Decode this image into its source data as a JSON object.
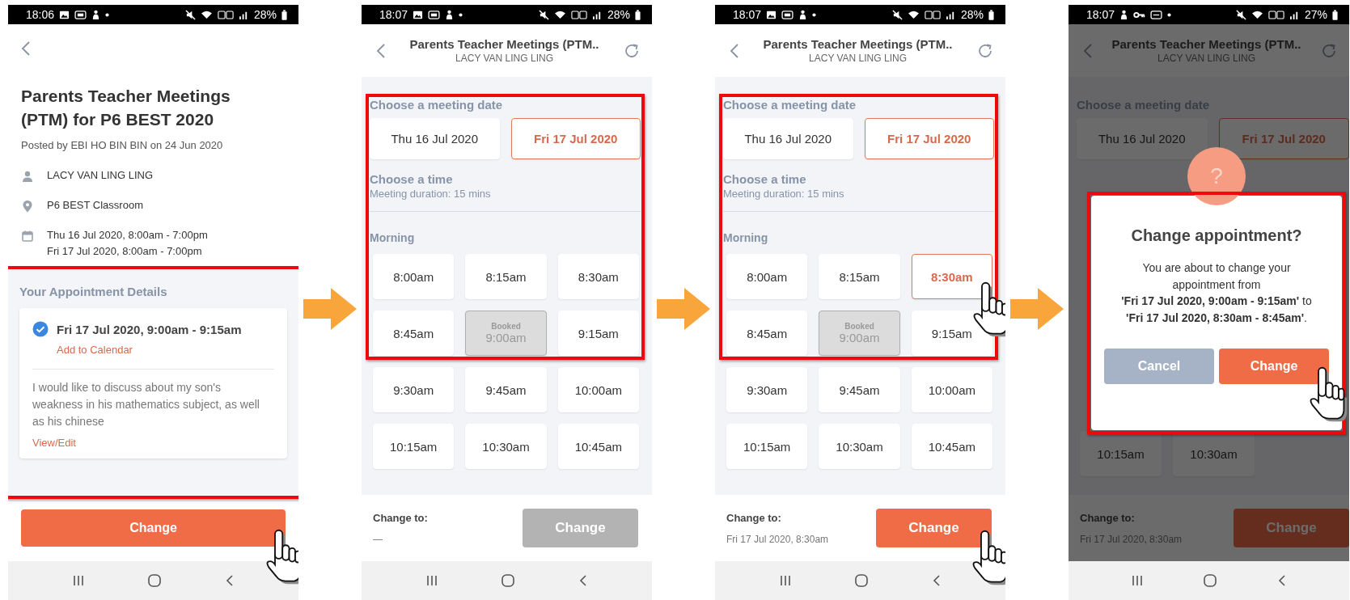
{
  "screens": [
    {
      "kind": "details",
      "status_bar": {
        "time": "18:06",
        "notifications": [
          {
            "kind": "image"
          },
          {
            "kind": "app"
          },
          {
            "kind": "figure"
          },
          {
            "kind": "dot"
          }
        ],
        "battery": "28%"
      },
      "title": "Parents Teacher Meetings (PTM) for P6 BEST 2020",
      "posted": "Posted by EBI HO BIN BIN on 24 Jun 2020",
      "info": [
        {
          "kind": "person",
          "lines": [
            "LACY VAN LING LING"
          ]
        },
        {
          "kind": "location",
          "lines": [
            "P6 BEST Classroom"
          ]
        },
        {
          "kind": "calendar",
          "lines": [
            "Thu 16 Jul 2020, 8:00am - 7:00pm",
            "Fri 17 Jul 2020, 8:00am - 7:00pm"
          ]
        }
      ],
      "appointment": {
        "heading": "Your Appointment Details",
        "highlighted": true,
        "confirmed": true,
        "slot": "Fri 17 Jul 2020, 9:00am - 9:15am",
        "calendar_link": "Add to Calendar",
        "note": "I would like to discuss about my son's weakness in his mathematics subject, as well as his chinese",
        "edit_link": "View/Edit"
      },
      "button": {
        "label": "Change",
        "disabled": false,
        "tapped": true
      }
    },
    {
      "kind": "picker",
      "status_bar": {
        "time": "18:07",
        "notifications": [
          {
            "kind": "image"
          },
          {
            "kind": "app"
          },
          {
            "kind": "figure"
          },
          {
            "kind": "dot"
          }
        ],
        "battery": "28%"
      },
      "header": {
        "title": "Parents Teacher Meetings (PTM..",
        "subtitle": "LACY VAN LING LING"
      },
      "date_section": {
        "heading": "Choose a meeting date",
        "highlighted": true,
        "dates": [
          {
            "label": "Thu 16 Jul 2020",
            "selected": false
          },
          {
            "label": "Fri 17 Jul 2020",
            "selected": true
          }
        ]
      },
      "time_section": {
        "heading": "Choose a time",
        "duration": "Meeting duration: 15 mins",
        "period": "Morning"
      },
      "slot_rows": [
        {
          "slots": [
            {
              "label": "8:00am",
              "selected": false,
              "booked": false
            },
            {
              "label": "8:15am",
              "selected": false,
              "booked": false
            },
            {
              "label": "8:30am",
              "selected": false,
              "booked": false
            }
          ]
        },
        {
          "slots": [
            {
              "label": "8:45am",
              "selected": false,
              "booked": false
            },
            {
              "label": "9:00am",
              "note": "Booked",
              "selected": false,
              "booked": true
            },
            {
              "label": "9:15am",
              "selected": false,
              "booked": false
            }
          ]
        },
        {
          "slots": [
            {
              "label": "9:30am",
              "selected": false,
              "booked": false
            },
            {
              "label": "9:45am",
              "selected": false,
              "booked": false
            },
            {
              "label": "10:00am",
              "selected": false,
              "booked": false
            }
          ]
        },
        {
          "slots": [
            {
              "label": "10:15am",
              "selected": false,
              "booked": false
            },
            {
              "label": "10:30am",
              "selected": false,
              "booked": false
            },
            {
              "label": "10:45am",
              "selected": false,
              "booked": false
            }
          ]
        }
      ],
      "footer": {
        "label": "Change to:",
        "value": "—",
        "button": {
          "label": "Change",
          "disabled": true,
          "tapped": false
        }
      }
    },
    {
      "kind": "picker",
      "status_bar": {
        "time": "18:07",
        "notifications": [
          {
            "kind": "image"
          },
          {
            "kind": "app"
          },
          {
            "kind": "figure"
          },
          {
            "kind": "dot"
          }
        ],
        "battery": "28%"
      },
      "header": {
        "title": "Parents Teacher Meetings (PTM..",
        "subtitle": "LACY VAN LING LING"
      },
      "date_section": {
        "heading": "Choose a meeting date",
        "highlighted": true,
        "dates": [
          {
            "label": "Thu 16 Jul 2020",
            "selected": false
          },
          {
            "label": "Fri 17 Jul 2020",
            "selected": true
          }
        ]
      },
      "time_section": {
        "heading": "Choose a time",
        "duration": "Meeting duration: 15 mins",
        "period": "Morning"
      },
      "slot_rows": [
        {
          "slots": [
            {
              "label": "8:00am",
              "selected": false,
              "booked": false
            },
            {
              "label": "8:15am",
              "selected": false,
              "booked": false
            },
            {
              "label": "8:30am",
              "selected": true,
              "booked": false
            }
          ]
        },
        {
          "slots": [
            {
              "label": "8:45am",
              "selected": false,
              "booked": false
            },
            {
              "label": "9:00am",
              "note": "Booked",
              "selected": false,
              "booked": true
            },
            {
              "label": "9:15am",
              "selected": false,
              "booked": false
            }
          ]
        },
        {
          "slots": [
            {
              "label": "9:30am",
              "selected": false,
              "booked": false
            },
            {
              "label": "9:45am",
              "selected": false,
              "booked": false
            },
            {
              "label": "10:00am",
              "selected": false,
              "booked": false
            }
          ]
        },
        {
          "slots": [
            {
              "label": "10:15am",
              "selected": false,
              "booked": false
            },
            {
              "label": "10:30am",
              "selected": false,
              "booked": false
            },
            {
              "label": "10:45am",
              "selected": false,
              "booked": false
            }
          ]
        }
      ],
      "footer": {
        "label": "Change to:",
        "value": "Fri 17 Jul 2020, 8:30am",
        "button": {
          "label": "Change",
          "disabled": false,
          "tapped": true
        }
      }
    },
    {
      "kind": "confirm",
      "status_bar": {
        "time": "18:07",
        "notifications": [
          {
            "kind": "figure"
          },
          {
            "kind": "key"
          },
          {
            "kind": "card"
          },
          {
            "kind": "dot"
          }
        ],
        "battery": "27%"
      },
      "header": {
        "title": "Parents Teacher Meetings (PTM..",
        "subtitle": "LACY VAN LING LING"
      },
      "date_section": {
        "heading": "Choose a meeting date",
        "highlighted": false,
        "dates": [
          {
            "label": "Thu 16 Jul 2020",
            "selected": false
          },
          {
            "label": "Fri 17 Jul 2020",
            "selected": true
          }
        ]
      },
      "slot_rows": [
        {
          "slots": [
            {
              "label": "10:15am",
              "selected": false,
              "booked": false
            },
            {
              "label": "10:30am",
              "selected": false,
              "booked": false
            }
          ]
        }
      ],
      "footer": {
        "label": "Change to:",
        "value": "Fri 17 Jul 2020, 8:30am",
        "button": {
          "label": "Change",
          "disabled": false,
          "tapped": false
        }
      },
      "dimmed": true,
      "dialog": {
        "glyph": "?",
        "title": "Change appointment?",
        "message": "You are about to change your\nappointment from\n**'Fri 17 Jul 2020, 9:00am - 9:15am'** to\n**'Fri 17 Jul 2020, 8:30am - 8:45am'**.",
        "highlighted": true,
        "buttons": [
          {
            "kind": "cancel",
            "label": "Cancel",
            "tapped": false
          },
          {
            "kind": "confirm",
            "label": "Change",
            "tapped": true
          }
        ]
      }
    }
  ]
}
